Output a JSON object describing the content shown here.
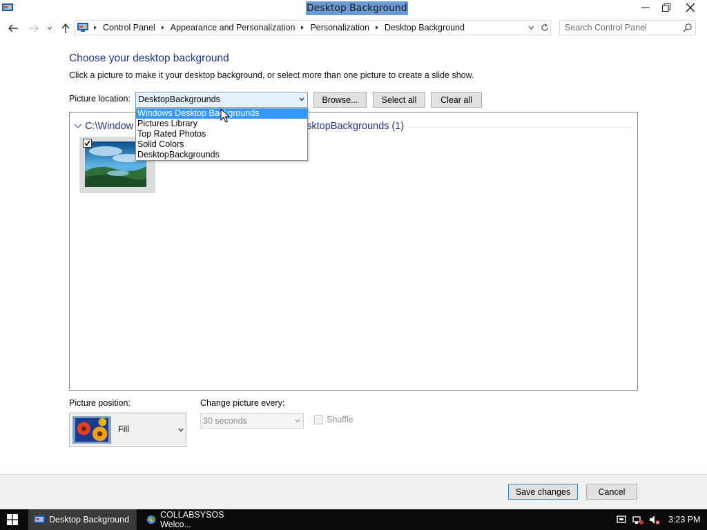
{
  "window": {
    "title": "Desktop Background"
  },
  "address_bar": {
    "breadcrumbs": [
      "Control Panel",
      "Appearance and Personalization",
      "Personalization",
      "Desktop Background"
    ]
  },
  "search": {
    "placeholder": "Search Control Panel"
  },
  "main": {
    "heading": "Choose your desktop background",
    "description": "Click a picture to make it your desktop background, or select more than one picture to create a slide show.",
    "picture_location_label": "Picture location:",
    "picture_location_value": "DesktopBackgrounds",
    "browse_label": "Browse...",
    "select_all_label": "Select all",
    "clear_all_label": "Clear all"
  },
  "dropdown": {
    "options": [
      "Windows Desktop Backgrounds",
      "Pictures Library",
      "Top Rated Photos",
      "Solid Colors",
      "DesktopBackgrounds"
    ],
    "highlighted_index": 0
  },
  "gallery": {
    "group_header_left": "C:\\Window",
    "group_header_right": "sktopBackgrounds (1)",
    "items": [
      {
        "checked": true,
        "icon": "landscape-thumbnail"
      }
    ]
  },
  "picture_position": {
    "label": "Picture position:",
    "value": "Fill"
  },
  "change_picture": {
    "label": "Change picture every:",
    "value": "30 seconds",
    "enabled": false
  },
  "shuffle": {
    "label": "Shuffle",
    "checked": false,
    "enabled": false
  },
  "footer": {
    "save_label": "Save changes",
    "cancel_label": "Cancel"
  },
  "taskbar": {
    "tasks": [
      {
        "label": "Desktop Background",
        "active": true
      },
      {
        "label": "COLLABSYSOS Welco...",
        "active": false
      }
    ],
    "clock": "3:23 PM"
  },
  "colors": {
    "heading": "#1e3287",
    "selection": "#3399ff",
    "title_highlight": "#6b9bd6",
    "taskbar": "#0b0b0b"
  }
}
